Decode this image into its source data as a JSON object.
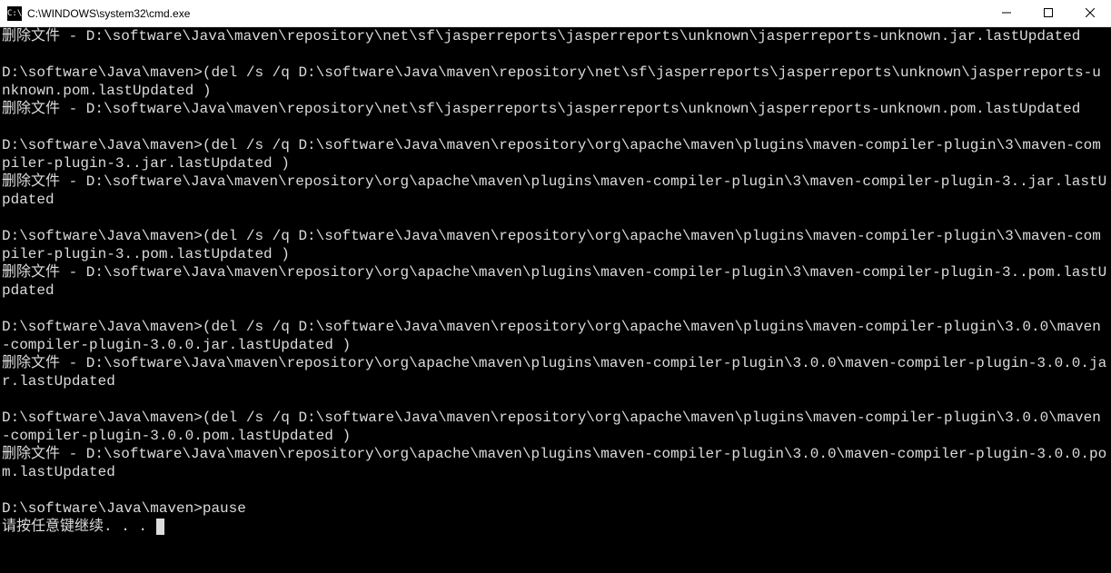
{
  "window": {
    "title": "C:\\WINDOWS\\system32\\cmd.exe",
    "icon_label": "C:\\"
  },
  "terminal": {
    "lines": [
      "删除文件 - D:\\software\\Java\\maven\\repository\\net\\sf\\jasperreports\\jasperreports\\unknown\\jasperreports-unknown.jar.lastUpdated",
      "",
      "D:\\software\\Java\\maven>(del /s /q D:\\software\\Java\\maven\\repository\\net\\sf\\jasperreports\\jasperreports\\unknown\\jasperreports-unknown.pom.lastUpdated )",
      "删除文件 - D:\\software\\Java\\maven\\repository\\net\\sf\\jasperreports\\jasperreports\\unknown\\jasperreports-unknown.pom.lastUpdated",
      "",
      "D:\\software\\Java\\maven>(del /s /q D:\\software\\Java\\maven\\repository\\org\\apache\\maven\\plugins\\maven-compiler-plugin\\3\\maven-compiler-plugin-3..jar.lastUpdated )",
      "删除文件 - D:\\software\\Java\\maven\\repository\\org\\apache\\maven\\plugins\\maven-compiler-plugin\\3\\maven-compiler-plugin-3..jar.lastUpdated",
      "",
      "D:\\software\\Java\\maven>(del /s /q D:\\software\\Java\\maven\\repository\\org\\apache\\maven\\plugins\\maven-compiler-plugin\\3\\maven-compiler-plugin-3..pom.lastUpdated )",
      "删除文件 - D:\\software\\Java\\maven\\repository\\org\\apache\\maven\\plugins\\maven-compiler-plugin\\3\\maven-compiler-plugin-3..pom.lastUpdated",
      "",
      "D:\\software\\Java\\maven>(del /s /q D:\\software\\Java\\maven\\repository\\org\\apache\\maven\\plugins\\maven-compiler-plugin\\3.0.0\\maven-compiler-plugin-3.0.0.jar.lastUpdated )",
      "删除文件 - D:\\software\\Java\\maven\\repository\\org\\apache\\maven\\plugins\\maven-compiler-plugin\\3.0.0\\maven-compiler-plugin-3.0.0.jar.lastUpdated",
      "",
      "D:\\software\\Java\\maven>(del /s /q D:\\software\\Java\\maven\\repository\\org\\apache\\maven\\plugins\\maven-compiler-plugin\\3.0.0\\maven-compiler-plugin-3.0.0.pom.lastUpdated )",
      "删除文件 - D:\\software\\Java\\maven\\repository\\org\\apache\\maven\\plugins\\maven-compiler-plugin\\3.0.0\\maven-compiler-plugin-3.0.0.pom.lastUpdated",
      "",
      "D:\\software\\Java\\maven>pause",
      "请按任意键继续. . . "
    ]
  }
}
